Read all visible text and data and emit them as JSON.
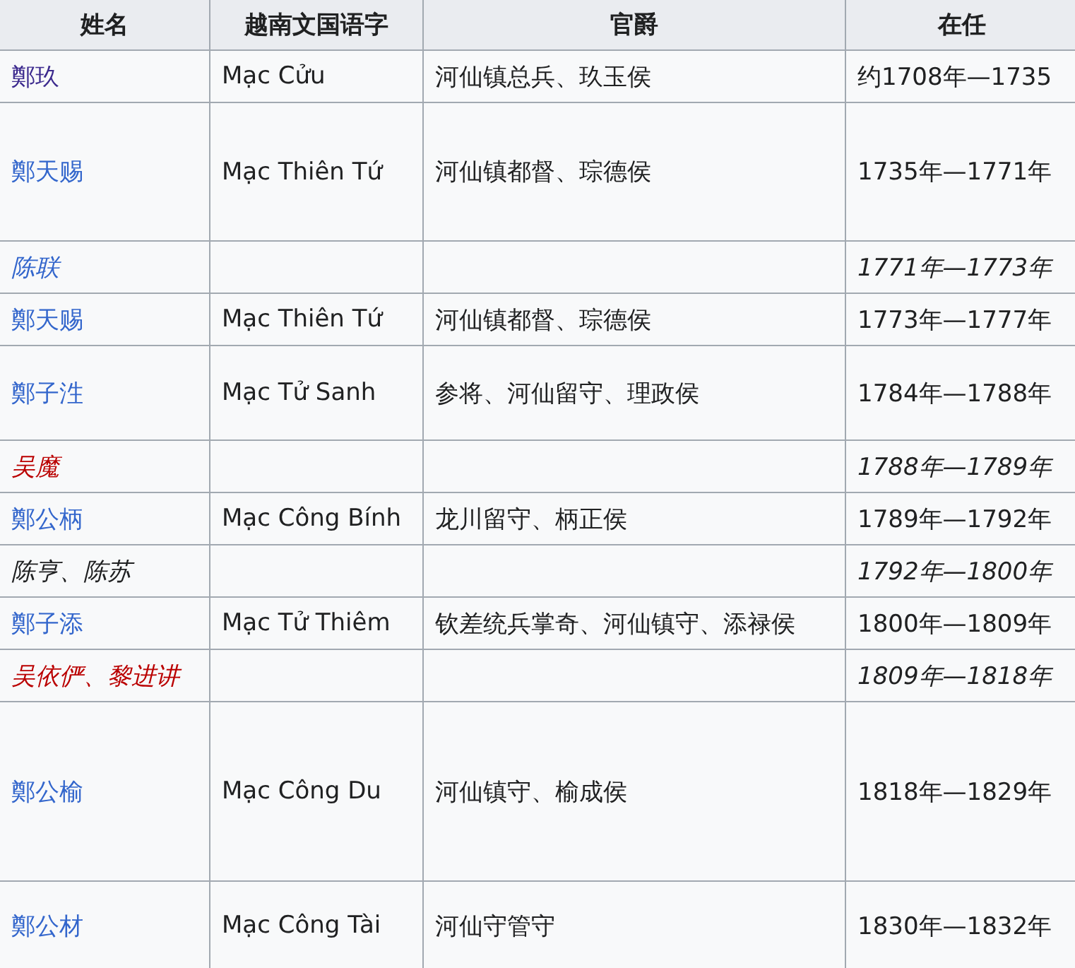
{
  "table": {
    "columns": [
      "姓名",
      "越南文国语字",
      "官爵",
      "在任"
    ],
    "rows": [
      {
        "name": "鄭玖",
        "kind": "visited",
        "interim": false,
        "quoc_ngu": "Mạc Cửu",
        "title": "河仙镇总兵、玖玉侯",
        "term": "约1708年—1735"
      },
      {
        "name": "鄭天赐",
        "kind": "link",
        "interim": false,
        "quoc_ngu": "Mạc Thiên Tứ",
        "title": "河仙镇都督、琮德侯",
        "term": "1735年—1771年"
      },
      {
        "name": "陈联",
        "kind": "link",
        "interim": true,
        "term": "1771年—1773年"
      },
      {
        "name": "鄭天赐",
        "kind": "link",
        "interim": false,
        "quoc_ngu": "Mạc Thiên Tứ",
        "title": "河仙镇都督、琮德侯",
        "term": "1773年—1777年"
      },
      {
        "name": "鄭子泩",
        "kind": "link",
        "interim": false,
        "quoc_ngu": "Mạc Tử Sanh",
        "title": "参将、河仙留守、理政侯",
        "term": "1784年—1788年"
      },
      {
        "name": "吴魔",
        "kind": "new",
        "interim": true,
        "term": "1788年—1789年"
      },
      {
        "name": "鄭公柄",
        "kind": "link",
        "interim": false,
        "quoc_ngu": "Mạc Công Bính",
        "title": "龙川留守、柄正侯",
        "term": "1789年—1792年"
      },
      {
        "name": "陈亨、陈苏",
        "kind": "plain",
        "interim": true,
        "term": "1792年—1800年"
      },
      {
        "name": "鄭子添",
        "kind": "link",
        "interim": false,
        "quoc_ngu": "Mạc Tử Thiêm",
        "title": "钦差统兵掌奇、河仙镇守、添禄侯",
        "term": "1800年—1809年"
      },
      {
        "name": "吴依俨、黎进讲",
        "kind": "new",
        "interim": true,
        "term": "1809年—1818年"
      },
      {
        "name": "鄭公榆",
        "kind": "link",
        "interim": false,
        "quoc_ngu": "Mạc Công Du",
        "title": "河仙镇守、榆成侯",
        "term": "1818年—1829年"
      },
      {
        "name": "鄭公材",
        "kind": "link",
        "interim": false,
        "quoc_ngu": "Mạc Công Tài",
        "title": "河仙守管守",
        "term": "1830年—1832年"
      }
    ]
  }
}
